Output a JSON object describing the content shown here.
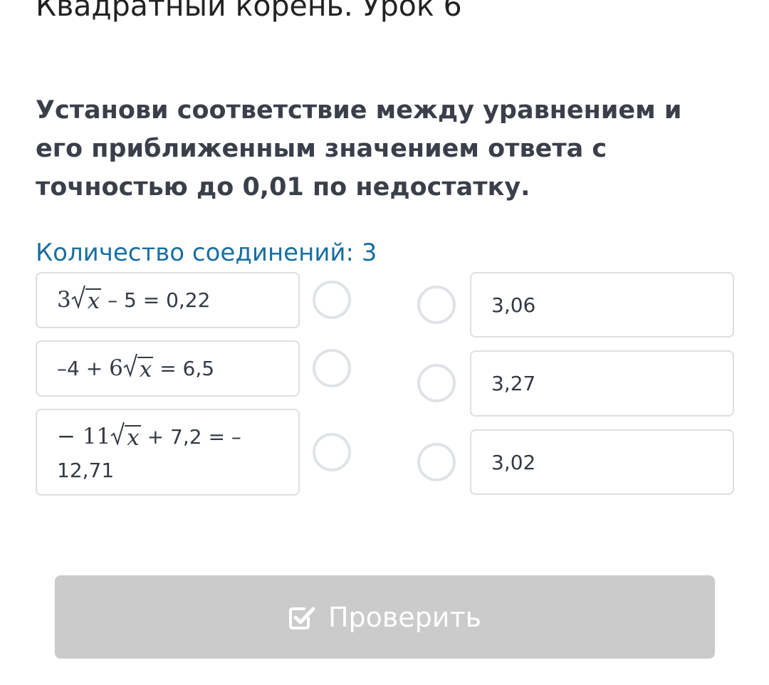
{
  "header": {
    "title": "Квадратный корень. Урок 6"
  },
  "task": {
    "text": "Установи соответствие между уравнением и его приближенным значением ответа с точностью до 0,01 по недостатку.",
    "connections_label": "Количество соединений: 3"
  },
  "left_items": [
    {
      "coef": "3",
      "var": "x",
      "rest": " – 5 = 0,22"
    },
    {
      "prefix": "–4 + ",
      "coef": "6",
      "var": "x",
      "rest": " = 6,5"
    },
    {
      "coef": "− 11",
      "var": "x",
      "rest": " + 7,2 = –",
      "rest2": "12,71"
    }
  ],
  "right_items": [
    {
      "label": "3,06"
    },
    {
      "label": "3,27"
    },
    {
      "label": "3,02"
    }
  ],
  "actions": {
    "check_label": "Проверить",
    "check_icon": "checkbox-check-icon"
  },
  "colors": {
    "accent": "#1a6fa0",
    "button_disabled": "#cbcbcb",
    "card_border": "#dcdfe3"
  }
}
